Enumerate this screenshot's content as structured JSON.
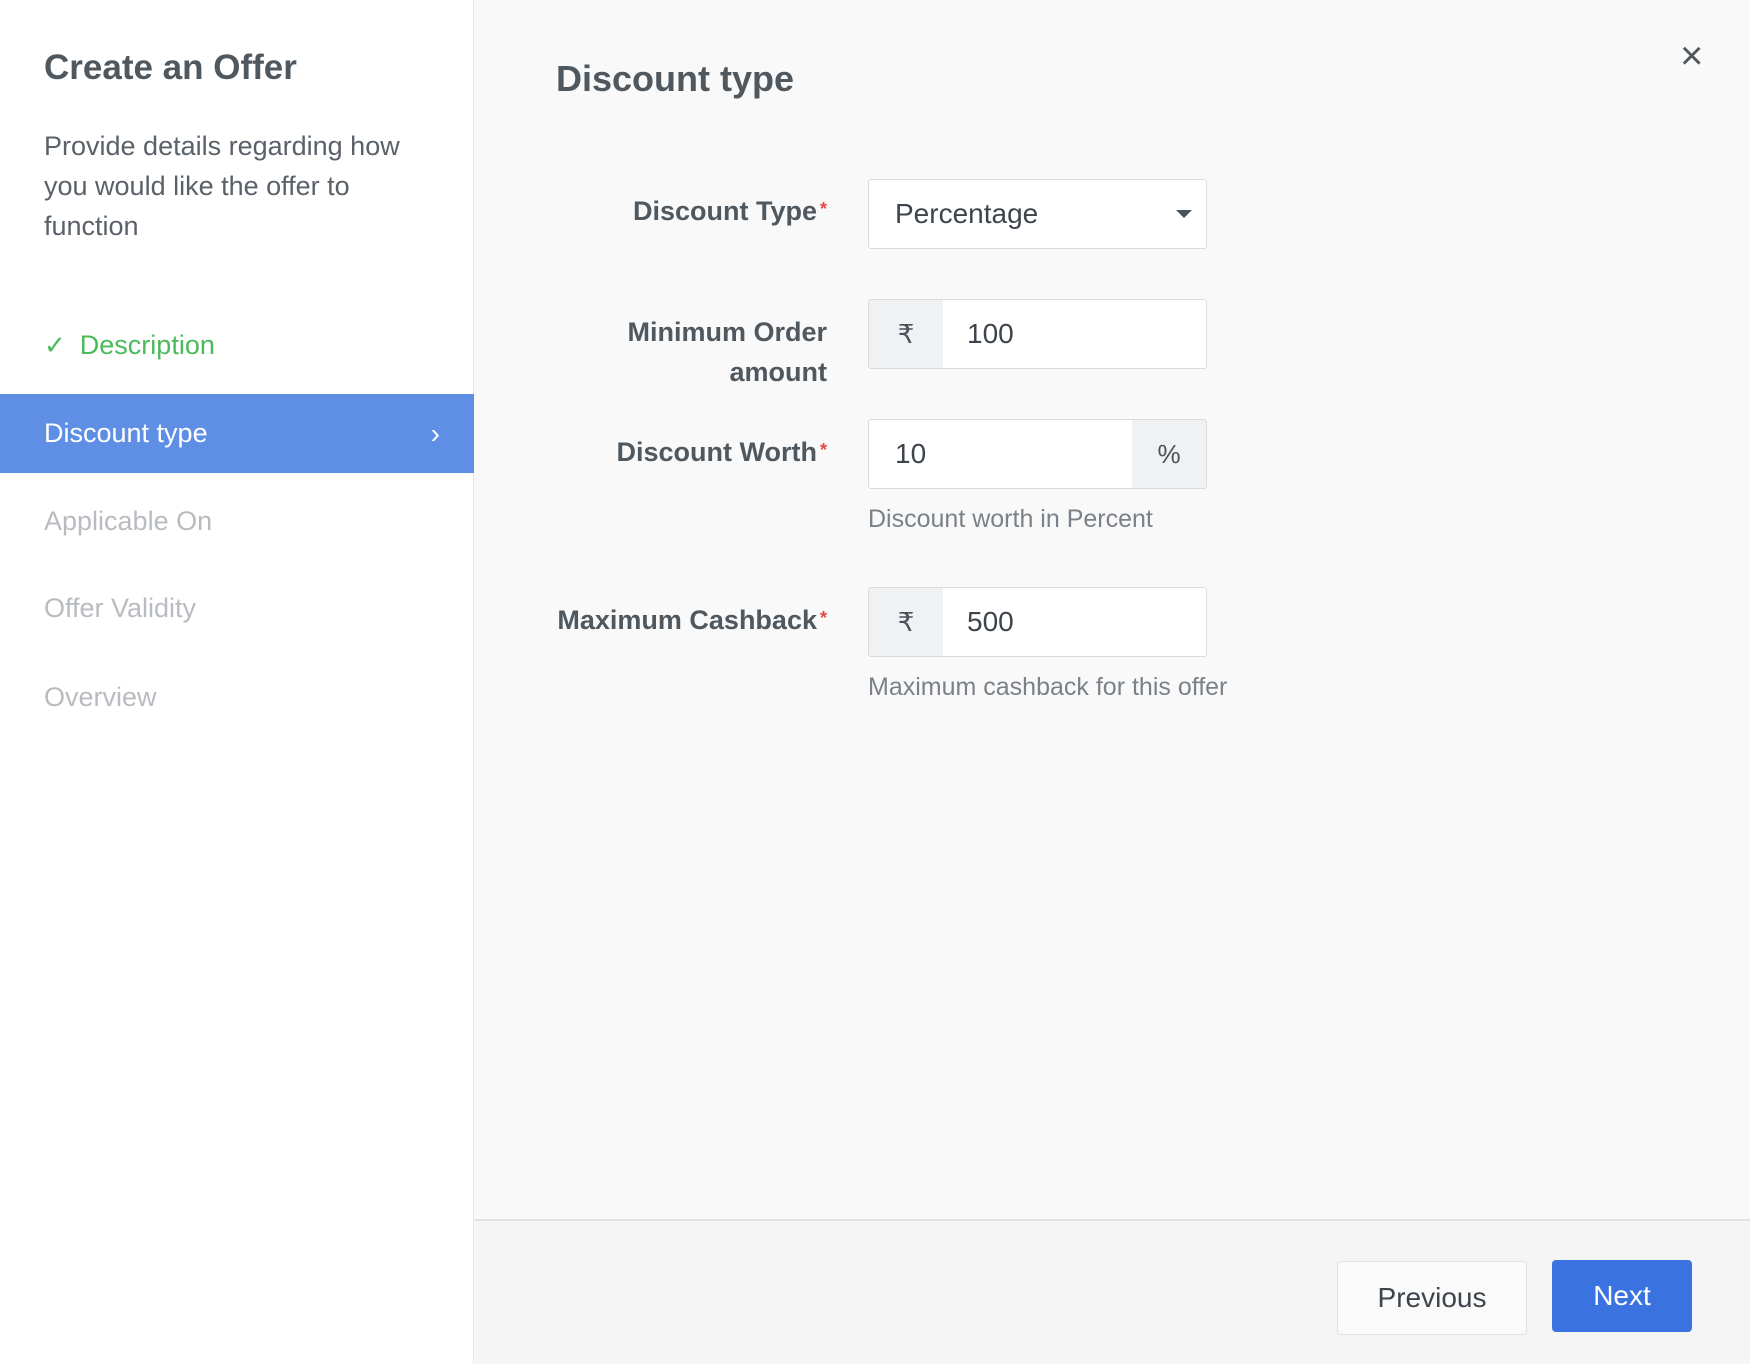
{
  "sidebar": {
    "title": "Create an Offer",
    "description": "Provide details regarding how you would like the offer to function",
    "steps": [
      {
        "label": "Description",
        "state": "completed",
        "icon": "check-icon"
      },
      {
        "label": "Discount type",
        "state": "active",
        "icon": "chevron-right-icon"
      },
      {
        "label": "Applicable On",
        "state": "pending"
      },
      {
        "label": "Offer Validity",
        "state": "pending"
      },
      {
        "label": "Overview",
        "state": "pending"
      }
    ]
  },
  "main": {
    "title": "Discount type",
    "close_icon": "×",
    "fields": {
      "discount_type": {
        "label": "Discount Type",
        "required": "*",
        "value": "Percentage"
      },
      "min_order": {
        "label": "Minimum Order amount",
        "prefix": "₹",
        "value": "100"
      },
      "discount_worth": {
        "label": "Discount Worth",
        "required": "*",
        "value": "10",
        "suffix": "%",
        "help": "Discount worth in Percent"
      },
      "max_cashback": {
        "label": "Maximum Cashback",
        "required": "*",
        "prefix": "₹",
        "value": "500",
        "help": "Maximum cashback for this offer"
      }
    }
  },
  "footer": {
    "previous_label": "Previous",
    "next_label": "Next"
  },
  "colors": {
    "active_step": "#5e8fe4",
    "completed_step": "#4cb95a",
    "primary_button": "#3a73e0",
    "required": "#e04848"
  }
}
